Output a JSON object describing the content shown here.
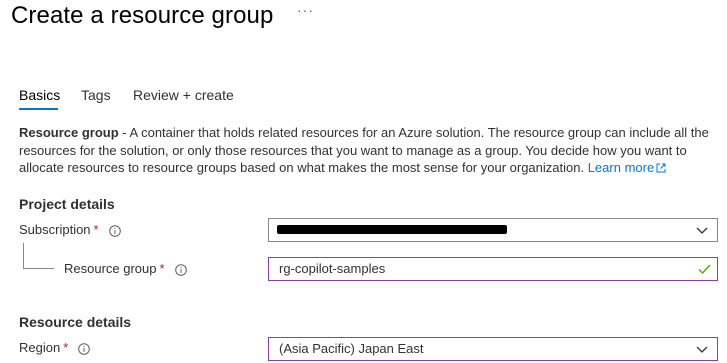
{
  "page": {
    "title": "Create a resource group",
    "more_label": "···"
  },
  "tabs": [
    {
      "label": "Basics",
      "active": true
    },
    {
      "label": "Tags",
      "active": false
    },
    {
      "label": "Review + create",
      "active": false
    }
  ],
  "description": {
    "bold_lead": "Resource group",
    "text": " - A container that holds related resources for an Azure solution. The resource group can include all the resources for the solution, or only those resources that you want to manage as a group. You decide how you want to allocate resources to resource groups based on what makes the most sense for your organization. ",
    "link_label": "Learn more"
  },
  "project_details": {
    "heading": "Project details",
    "subscription": {
      "label": "Subscription",
      "required": "*",
      "value_redacted": true
    },
    "resource_group": {
      "label": "Resource group",
      "required": "*",
      "value": "rg-copilot-samples",
      "valid": true
    }
  },
  "resource_details": {
    "heading": "Resource details",
    "region": {
      "label": "Region",
      "required": "*",
      "value": "(Asia Pacific) Japan East"
    }
  },
  "colors": {
    "accent": "#0078d4",
    "required": "#a4262c",
    "valid_check": "#57a300",
    "focus_border": "#8a3fa5"
  },
  "icons": {
    "more": "ellipsis-icon",
    "info": "info-icon",
    "dropdown": "chevron-down-icon",
    "valid": "checkmark-icon",
    "external_link": "external-link-icon"
  }
}
